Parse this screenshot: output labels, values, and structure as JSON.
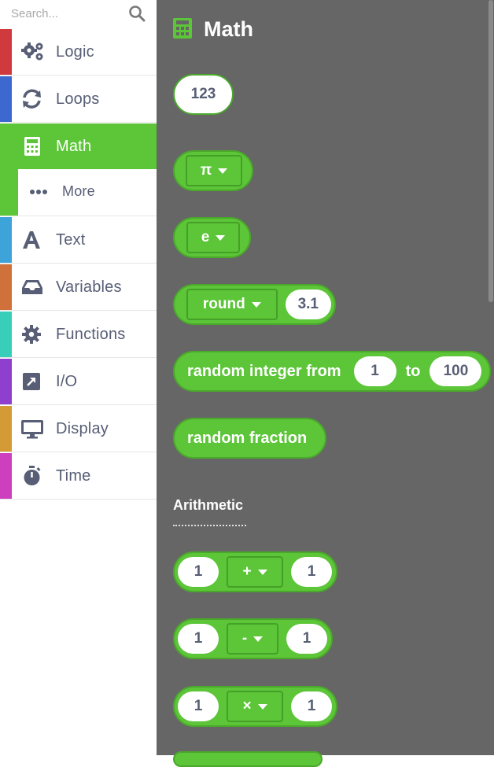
{
  "search": {
    "placeholder": "Search..."
  },
  "categories": [
    {
      "label": "Logic",
      "color": "#d0393d",
      "icon": "gears-icon"
    },
    {
      "label": "Loops",
      "color": "#3d68cf",
      "icon": "refresh-icon"
    },
    {
      "label": "Math",
      "color": "#5cc538",
      "icon": "calculator-icon",
      "selected": true
    },
    {
      "label": "More",
      "color": "#5cc538",
      "icon": "ellipsis-icon",
      "sub": true
    },
    {
      "label": "Text",
      "color": "#3da3d8",
      "icon": "text-a-icon"
    },
    {
      "label": "Variables",
      "color": "#d0703a",
      "icon": "inbox-icon"
    },
    {
      "label": "Functions",
      "color": "#39ceb9",
      "icon": "gear-icon"
    },
    {
      "label": "I/O",
      "color": "#8f3fce",
      "icon": "arrow-box-icon"
    },
    {
      "label": "Display",
      "color": "#d49a35",
      "icon": "monitor-icon"
    },
    {
      "label": "Time",
      "color": "#ce3fbd",
      "icon": "stopwatch-icon"
    }
  ],
  "flyout": {
    "title": "Math",
    "blocks": {
      "number": "123",
      "pi": "π",
      "e": "e",
      "round": {
        "op": "round",
        "value": "3.1"
      },
      "random_int": {
        "label": "random integer from",
        "from": "1",
        "to_label": "to",
        "to": "100"
      },
      "random_fraction": "random fraction",
      "section_label": "Arithmetic",
      "add": {
        "a": "1",
        "op": "+",
        "b": "1"
      },
      "sub": {
        "a": "1",
        "op": "-",
        "b": "1"
      },
      "mul": {
        "a": "1",
        "op": "×",
        "b": "1"
      }
    }
  },
  "colors": {
    "math_green": "#5cc538",
    "flyout_bg": "#666666",
    "text_dark": "#575e75"
  }
}
